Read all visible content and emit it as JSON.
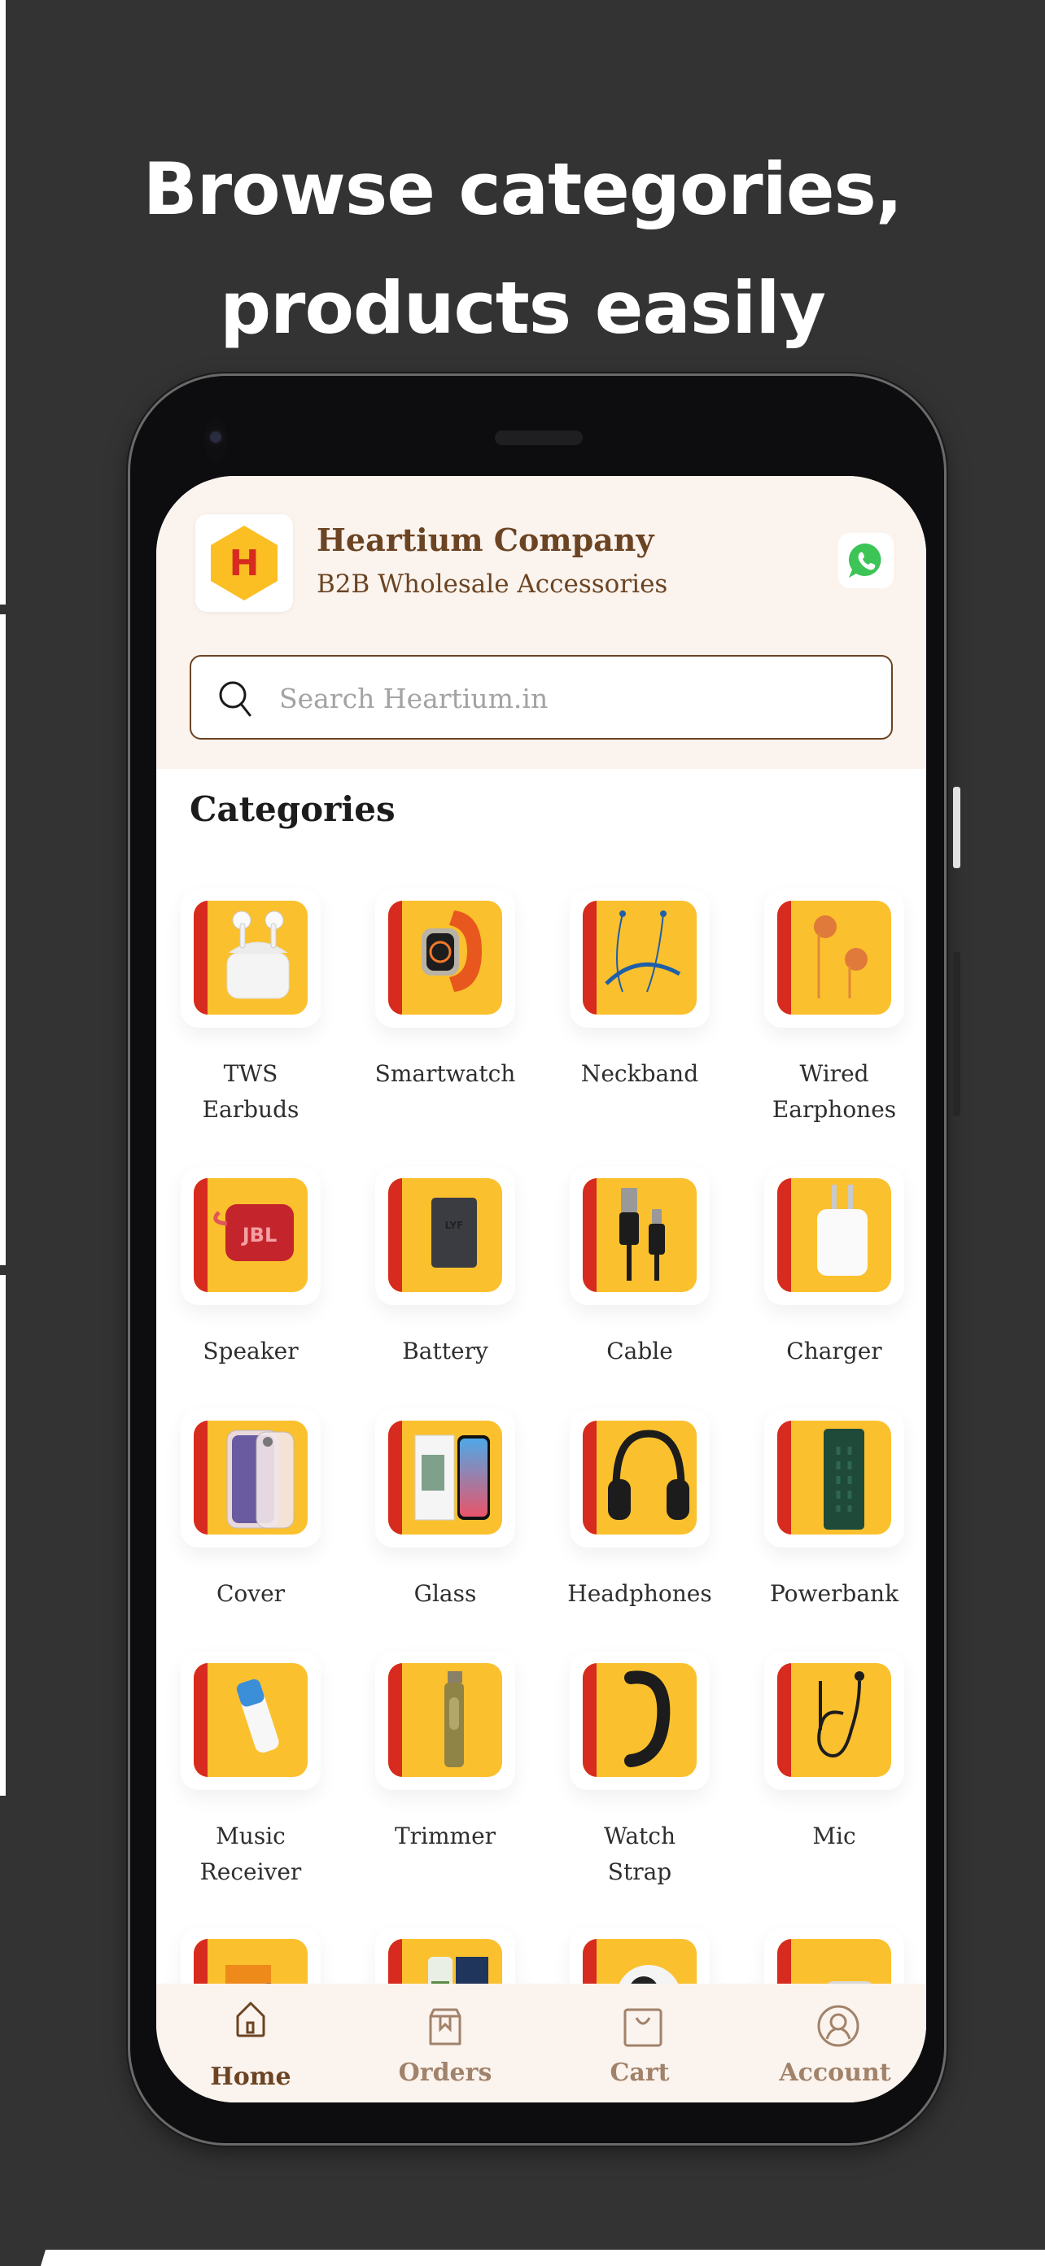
{
  "headline": [
    "Browse categories,",
    "products easily"
  ],
  "app": {
    "brand_title": "Heartium Company",
    "brand_subtitle": "B2B Wholesale Accessories",
    "logo_letter": "H",
    "contact_icon": "whatsapp-icon",
    "search": {
      "placeholder": "Search Heartium.in",
      "value": ""
    },
    "section_title": "Categories",
    "categories": [
      {
        "label": "TWS\nEarbuds",
        "icon": "earbuds"
      },
      {
        "label": "Smartwatch",
        "icon": "smartwatch"
      },
      {
        "label": "Neckband",
        "icon": "neckband"
      },
      {
        "label": "Wired\nEarphones",
        "icon": "earphones"
      },
      {
        "label": "Speaker",
        "icon": "speaker"
      },
      {
        "label": "Battery",
        "icon": "battery"
      },
      {
        "label": "Cable",
        "icon": "cable"
      },
      {
        "label": "Charger",
        "icon": "charger"
      },
      {
        "label": "Cover",
        "icon": "phone-cover"
      },
      {
        "label": "Glass",
        "icon": "screen-glass"
      },
      {
        "label": "Headphones",
        "icon": "headphones"
      },
      {
        "label": "Powerbank",
        "icon": "powerbank"
      },
      {
        "label": "Music\nReceiver",
        "icon": "music-receiver"
      },
      {
        "label": "Trimmer",
        "icon": "trimmer"
      },
      {
        "label": "Watch\nStrap",
        "icon": "watch-strap"
      },
      {
        "label": "Mic",
        "icon": "mic"
      },
      {
        "label": "",
        "icon": "gadget-box"
      },
      {
        "label": "",
        "icon": "blender-bottle"
      },
      {
        "label": "",
        "icon": "security-camera"
      },
      {
        "label": "",
        "icon": "accessory"
      }
    ],
    "nav": [
      {
        "label": "Home",
        "icon": "home-icon",
        "active": true
      },
      {
        "label": "Orders",
        "icon": "orders-box-icon",
        "active": false
      },
      {
        "label": "Cart",
        "icon": "shopping-bag-icon",
        "active": false
      },
      {
        "label": "Account",
        "icon": "account-icon",
        "active": false
      }
    ]
  },
  "colors": {
    "background": "#333333",
    "brand_brown": "#6b4423",
    "nav_inactive": "#a1826a",
    "header_bg": "#fbf3ed",
    "tile_yellow": "#fbc02d",
    "tile_red": "#d62b1e",
    "whatsapp_green": "#3cc456"
  }
}
